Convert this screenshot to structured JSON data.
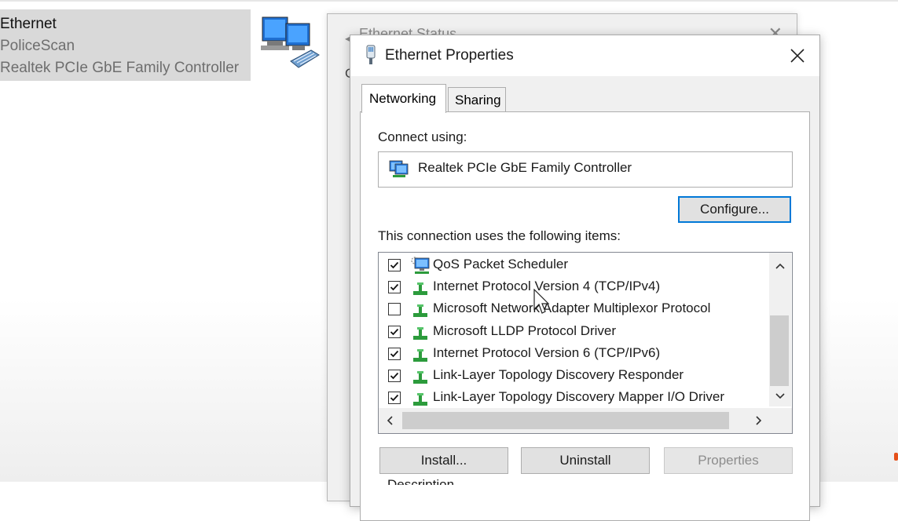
{
  "adapter_tile": {
    "name": "Ethernet",
    "network": "PoliceScan",
    "device": "Realtek PCIe GbE Family Controller"
  },
  "status_window": {
    "title": "Ethernet Status",
    "peek_text": "G"
  },
  "properties_window": {
    "title": "Ethernet Properties",
    "tabs": [
      {
        "label": "Networking",
        "active": true
      },
      {
        "label": "Sharing",
        "active": false
      }
    ],
    "connect_using_label": "Connect using:",
    "adapter_name": "Realtek PCIe GbE Family Controller",
    "configure_label": "Configure...",
    "items_label": "This connection uses the following items:",
    "items": [
      {
        "label": "QoS Packet Scheduler",
        "checked": true,
        "icon": "network-service-icon"
      },
      {
        "label": "Internet Protocol Version 4 (TCP/IPv4)",
        "checked": true,
        "icon": "protocol-icon"
      },
      {
        "label": "Microsoft Network Adapter Multiplexor Protocol",
        "checked": false,
        "icon": "protocol-icon"
      },
      {
        "label": "Microsoft LLDP Protocol Driver",
        "checked": true,
        "icon": "protocol-icon"
      },
      {
        "label": "Internet Protocol Version 6 (TCP/IPv6)",
        "checked": true,
        "icon": "protocol-icon"
      },
      {
        "label": "Link-Layer Topology Discovery Responder",
        "checked": true,
        "icon": "protocol-icon"
      },
      {
        "label": "Link-Layer Topology Discovery Mapper I/O Driver",
        "checked": true,
        "icon": "protocol-icon"
      }
    ],
    "buttons": {
      "install": "Install...",
      "uninstall": "Uninstall",
      "properties": "Properties"
    },
    "description_label": "Description"
  },
  "colors": {
    "accent": "#0078d7",
    "tile_bg": "#d9d9d9",
    "dialog_bg": "#f0f0f0"
  }
}
